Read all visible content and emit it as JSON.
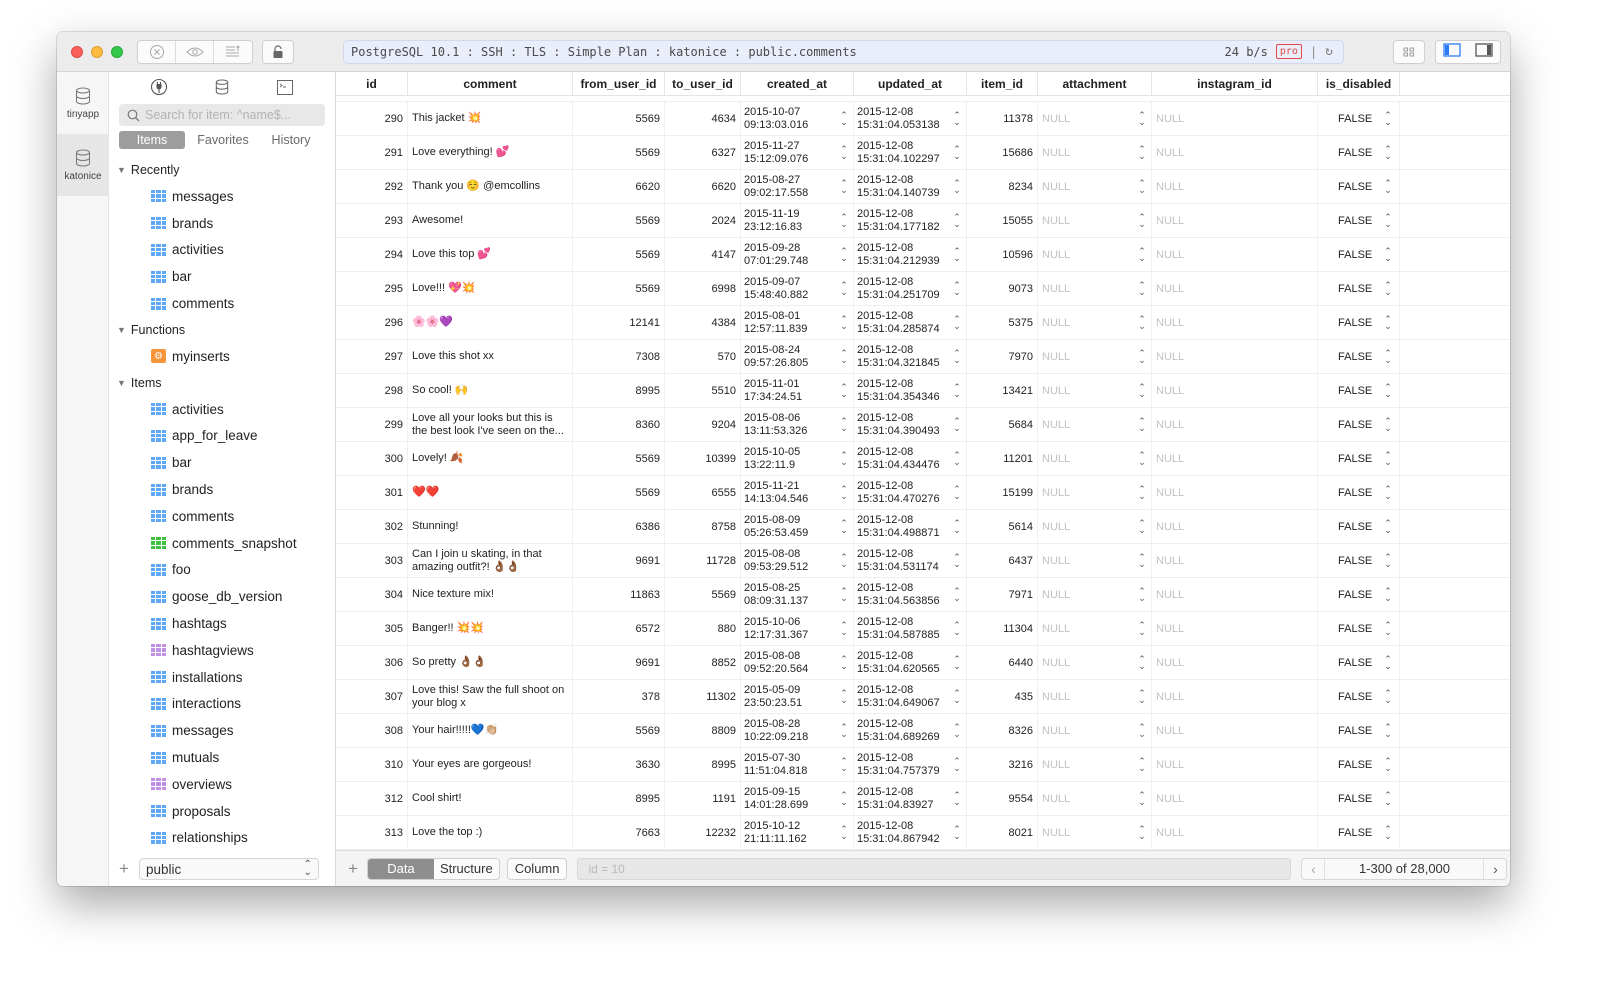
{
  "titlebar": {
    "address": "PostgreSQL 10.1 : SSH : TLS : Simple Plan : katonice : public.comments",
    "speed": "24 b/s",
    "pro_badge": "pro"
  },
  "connections": [
    {
      "label": "tinyapp",
      "icon": "database-icon",
      "active": false
    },
    {
      "label": "katonice",
      "icon": "database-icon",
      "active": true
    }
  ],
  "sidebar": {
    "search_placeholder": "Search for item: ^name$...",
    "segments": [
      "Items",
      "Favorites",
      "History"
    ],
    "active_segment": "Items",
    "groups": [
      {
        "title": "Recently",
        "items": [
          {
            "name": "messages",
            "kind": "table"
          },
          {
            "name": "brands",
            "kind": "table"
          },
          {
            "name": "activities",
            "kind": "table"
          },
          {
            "name": "bar",
            "kind": "table"
          },
          {
            "name": "comments",
            "kind": "table"
          }
        ]
      },
      {
        "title": "Functions",
        "items": [
          {
            "name": "myinserts",
            "kind": "function"
          }
        ]
      },
      {
        "title": "Items",
        "items": [
          {
            "name": "activities",
            "kind": "table"
          },
          {
            "name": "app_for_leave",
            "kind": "table"
          },
          {
            "name": "bar",
            "kind": "table"
          },
          {
            "name": "brands",
            "kind": "table"
          },
          {
            "name": "comments",
            "kind": "table"
          },
          {
            "name": "comments_snapshot",
            "kind": "matview"
          },
          {
            "name": "foo",
            "kind": "table"
          },
          {
            "name": "goose_db_version",
            "kind": "table"
          },
          {
            "name": "hashtags",
            "kind": "table"
          },
          {
            "name": "hashtagviews",
            "kind": "view"
          },
          {
            "name": "installations",
            "kind": "table"
          },
          {
            "name": "interactions",
            "kind": "table"
          },
          {
            "name": "messages",
            "kind": "table"
          },
          {
            "name": "mutuals",
            "kind": "table"
          },
          {
            "name": "overviews",
            "kind": "view"
          },
          {
            "name": "proposals",
            "kind": "table"
          },
          {
            "name": "relationships",
            "kind": "table"
          }
        ]
      }
    ],
    "schema": "public"
  },
  "colors": {
    "table": "#5fa8f5",
    "matview": "#3fc13f",
    "view": "#c08fe6",
    "function": "#f6953a",
    "null_text": "#c2c2c2",
    "pro": "#e04a4a"
  },
  "table": {
    "columns": [
      "id",
      "comment",
      "from_user_id",
      "to_user_id",
      "created_at",
      "updated_at",
      "item_id",
      "attachment",
      "instagram_id",
      "is_disabled"
    ],
    "rows": [
      {
        "id": "290",
        "comment": "This jacket 💥",
        "from_user_id": "5569",
        "to_user_id": "4634",
        "created_date": "2015-10-07",
        "created_time": "09:13:03.016",
        "updated_date": "2015-12-08",
        "updated_time": "15:31:04.053138",
        "item_id": "11378",
        "attachment": "NULL",
        "instagram_id": "NULL",
        "is_disabled": "FALSE"
      },
      {
        "id": "291",
        "comment": "Love everything! 💕",
        "from_user_id": "5569",
        "to_user_id": "6327",
        "created_date": "2015-11-27",
        "created_time": "15:12:09.076",
        "updated_date": "2015-12-08",
        "updated_time": "15:31:04.102297",
        "item_id": "15686",
        "attachment": "NULL",
        "instagram_id": "NULL",
        "is_disabled": "FALSE"
      },
      {
        "id": "292",
        "comment": "Thank you ☺️ @emcollins",
        "from_user_id": "6620",
        "to_user_id": "6620",
        "created_date": "2015-08-27",
        "created_time": "09:02:17.558",
        "updated_date": "2015-12-08",
        "updated_time": "15:31:04.140739",
        "item_id": "8234",
        "attachment": "NULL",
        "instagram_id": "NULL",
        "is_disabled": "FALSE"
      },
      {
        "id": "293",
        "comment": "Awesome!",
        "from_user_id": "5569",
        "to_user_id": "2024",
        "created_date": "2015-11-19",
        "created_time": "23:12:16.83",
        "updated_date": "2015-12-08",
        "updated_time": "15:31:04.177182",
        "item_id": "15055",
        "attachment": "NULL",
        "instagram_id": "NULL",
        "is_disabled": "FALSE"
      },
      {
        "id": "294",
        "comment": "Love this top 💕",
        "from_user_id": "5569",
        "to_user_id": "4147",
        "created_date": "2015-09-28",
        "created_time": "07:01:29.748",
        "updated_date": "2015-12-08",
        "updated_time": "15:31:04.212939",
        "item_id": "10596",
        "attachment": "NULL",
        "instagram_id": "NULL",
        "is_disabled": "FALSE"
      },
      {
        "id": "295",
        "comment": "Love!!! 💖💥",
        "from_user_id": "5569",
        "to_user_id": "6998",
        "created_date": "2015-09-07",
        "created_time": "15:48:40.882",
        "updated_date": "2015-12-08",
        "updated_time": "15:31:04.251709",
        "item_id": "9073",
        "attachment": "NULL",
        "instagram_id": "NULL",
        "is_disabled": "FALSE"
      },
      {
        "id": "296",
        "comment": "🌸🌸💜",
        "from_user_id": "12141",
        "to_user_id": "4384",
        "created_date": "2015-08-01",
        "created_time": "12:57:11.839",
        "updated_date": "2015-12-08",
        "updated_time": "15:31:04.285874",
        "item_id": "5375",
        "attachment": "NULL",
        "instagram_id": "NULL",
        "is_disabled": "FALSE"
      },
      {
        "id": "297",
        "comment": "Love this shot xx",
        "from_user_id": "7308",
        "to_user_id": "570",
        "created_date": "2015-08-24",
        "created_time": "09:57:26.805",
        "updated_date": "2015-12-08",
        "updated_time": "15:31:04.321845",
        "item_id": "7970",
        "attachment": "NULL",
        "instagram_id": "NULL",
        "is_disabled": "FALSE"
      },
      {
        "id": "298",
        "comment": "So cool! 🙌",
        "from_user_id": "8995",
        "to_user_id": "5510",
        "created_date": "2015-11-01",
        "created_time": "17:34:24.51",
        "updated_date": "2015-12-08",
        "updated_time": "15:31:04.354346",
        "item_id": "13421",
        "attachment": "NULL",
        "instagram_id": "NULL",
        "is_disabled": "FALSE"
      },
      {
        "id": "299",
        "comment": "Love all your looks but this is the best look I've seen on the...",
        "from_user_id": "8360",
        "to_user_id": "9204",
        "created_date": "2015-08-06",
        "created_time": "13:11:53.326",
        "updated_date": "2015-12-08",
        "updated_time": "15:31:04.390493",
        "item_id": "5684",
        "attachment": "NULL",
        "instagram_id": "NULL",
        "is_disabled": "FALSE"
      },
      {
        "id": "300",
        "comment": "Lovely! 🍂",
        "from_user_id": "5569",
        "to_user_id": "10399",
        "created_date": "2015-10-05",
        "created_time": "13:22:11.9",
        "updated_date": "2015-12-08",
        "updated_time": "15:31:04.434476",
        "item_id": "11201",
        "attachment": "NULL",
        "instagram_id": "NULL",
        "is_disabled": "FALSE"
      },
      {
        "id": "301",
        "comment": "❤️❤️",
        "from_user_id": "5569",
        "to_user_id": "6555",
        "created_date": "2015-11-21",
        "created_time": "14:13:04.546",
        "updated_date": "2015-12-08",
        "updated_time": "15:31:04.470276",
        "item_id": "15199",
        "attachment": "NULL",
        "instagram_id": "NULL",
        "is_disabled": "FALSE"
      },
      {
        "id": "302",
        "comment": "Stunning!",
        "from_user_id": "6386",
        "to_user_id": "8758",
        "created_date": "2015-08-09",
        "created_time": "05:26:53.459",
        "updated_date": "2015-12-08",
        "updated_time": "15:31:04.498871",
        "item_id": "5614",
        "attachment": "NULL",
        "instagram_id": "NULL",
        "is_disabled": "FALSE"
      },
      {
        "id": "303",
        "comment": "Can I join u skating, in that amazing outfit?! 👌🏾👌🏾",
        "from_user_id": "9691",
        "to_user_id": "11728",
        "created_date": "2015-08-08",
        "created_time": "09:53:29.512",
        "updated_date": "2015-12-08",
        "updated_time": "15:31:04.531174",
        "item_id": "6437",
        "attachment": "NULL",
        "instagram_id": "NULL",
        "is_disabled": "FALSE"
      },
      {
        "id": "304",
        "comment": "Nice texture mix!",
        "from_user_id": "11863",
        "to_user_id": "5569",
        "created_date": "2015-08-25",
        "created_time": "08:09:31.137",
        "updated_date": "2015-12-08",
        "updated_time": "15:31:04.563856",
        "item_id": "7971",
        "attachment": "NULL",
        "instagram_id": "NULL",
        "is_disabled": "FALSE"
      },
      {
        "id": "305",
        "comment": "Banger!! 💥💥",
        "from_user_id": "6572",
        "to_user_id": "880",
        "created_date": "2015-10-06",
        "created_time": "12:17:31.367",
        "updated_date": "2015-12-08",
        "updated_time": "15:31:04.587885",
        "item_id": "11304",
        "attachment": "NULL",
        "instagram_id": "NULL",
        "is_disabled": "FALSE"
      },
      {
        "id": "306",
        "comment": "So pretty 👌🏾👌🏾",
        "from_user_id": "9691",
        "to_user_id": "8852",
        "created_date": "2015-08-08",
        "created_time": "09:52:20.564",
        "updated_date": "2015-12-08",
        "updated_time": "15:31:04.620565",
        "item_id": "6440",
        "attachment": "NULL",
        "instagram_id": "NULL",
        "is_disabled": "FALSE"
      },
      {
        "id": "307",
        "comment": " Love this! Saw the full shoot on your blog x",
        "from_user_id": "378",
        "to_user_id": "11302",
        "created_date": "2015-05-09",
        "created_time": "23:50:23.51",
        "updated_date": "2015-12-08",
        "updated_time": "15:31:04.649067",
        "item_id": "435",
        "attachment": "NULL",
        "instagram_id": "NULL",
        "is_disabled": "FALSE"
      },
      {
        "id": "308",
        "comment": "Your hair!!!!!💙👏🏼",
        "from_user_id": "5569",
        "to_user_id": "8809",
        "created_date": "2015-08-28",
        "created_time": "10:22:09.218",
        "updated_date": "2015-12-08",
        "updated_time": "15:31:04.689269",
        "item_id": "8326",
        "attachment": "NULL",
        "instagram_id": "NULL",
        "is_disabled": "FALSE"
      },
      {
        "id": "310",
        "comment": "Your eyes are gorgeous!",
        "from_user_id": "3630",
        "to_user_id": "8995",
        "created_date": "2015-07-30",
        "created_time": "11:51:04.818",
        "updated_date": "2015-12-08",
        "updated_time": "15:31:04.757379",
        "item_id": "3216",
        "attachment": "NULL",
        "instagram_id": "NULL",
        "is_disabled": "FALSE"
      },
      {
        "id": "312",
        "comment": "Cool shirt!",
        "from_user_id": "8995",
        "to_user_id": "1191",
        "created_date": "2015-09-15",
        "created_time": "14:01:28.699",
        "updated_date": "2015-12-08",
        "updated_time": "15:31:04.83927",
        "item_id": "9554",
        "attachment": "NULL",
        "instagram_id": "NULL",
        "is_disabled": "FALSE"
      },
      {
        "id": "313",
        "comment": "Love the top :)",
        "from_user_id": "7663",
        "to_user_id": "12232",
        "created_date": "2015-10-12",
        "created_time": "21:11:11.162",
        "updated_date": "2015-12-08",
        "updated_time": "15:31:04.867942",
        "item_id": "8021",
        "attachment": "NULL",
        "instagram_id": "NULL",
        "is_disabled": "FALSE"
      }
    ]
  },
  "bottombar": {
    "tabs": [
      "Data",
      "Structure"
    ],
    "active_tab": "Data",
    "column_button": "Column",
    "filter_placeholder": "id = 10",
    "pagination": "1-300 of 28,000"
  }
}
